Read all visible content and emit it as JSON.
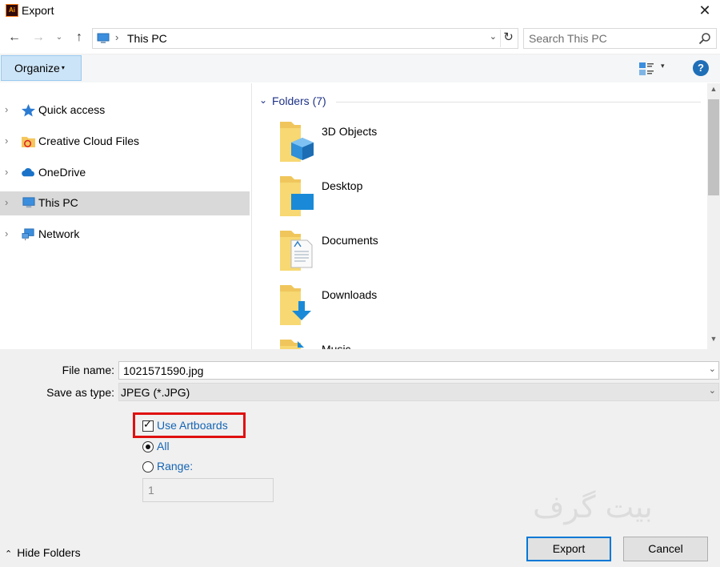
{
  "window": {
    "title": "Export",
    "app_icon_text": "Ai",
    "close_glyph": "✕"
  },
  "nav": {
    "back_glyph": "←",
    "forward_glyph": "→",
    "recent_glyph": "⌄",
    "up_glyph": "↑",
    "address_separator": "›",
    "address_text": "This PC",
    "address_dropdown_glyph": "⌄",
    "refresh_glyph": "↻",
    "search_placeholder": "Search This PC"
  },
  "toolbar": {
    "organize_label": "Organize",
    "organize_caret": "▾",
    "view_caret": "▾",
    "help_label": "?"
  },
  "sidebar": {
    "items": [
      {
        "label": "Quick access",
        "icon": "star-icon"
      },
      {
        "label": "Creative Cloud Files",
        "icon": "creative-cloud-folder-icon"
      },
      {
        "label": "OneDrive",
        "icon": "cloud-icon"
      },
      {
        "label": "This PC",
        "icon": "computer-icon",
        "selected": true
      },
      {
        "label": "Network",
        "icon": "network-icon"
      }
    ],
    "chevron_glyph": "›"
  },
  "content": {
    "group_label": "Folders (7)",
    "group_chevron": "⌄",
    "folders": [
      {
        "name": "3D Objects",
        "icon": "3d-objects-folder-icon"
      },
      {
        "name": "Desktop",
        "icon": "desktop-folder-icon"
      },
      {
        "name": "Documents",
        "icon": "documents-folder-icon"
      },
      {
        "name": "Downloads",
        "icon": "downloads-folder-icon"
      },
      {
        "name": "Music",
        "icon": "music-folder-icon"
      }
    ]
  },
  "scrollbar": {
    "up_glyph": "▲",
    "down_glyph": "▼"
  },
  "form": {
    "file_name_label": "File name:",
    "file_name_value": "1021571590.jpg",
    "save_as_type_label": "Save as type:",
    "save_as_type_value": "JPEG (*.JPG)",
    "dropdown_glyph": "⌄",
    "use_artboards_label": "Use Artboards",
    "use_artboards_checked": true,
    "check_glyph": "✓",
    "all_label": "All",
    "range_label": "Range:",
    "range_value": "1"
  },
  "watermark_text": "بیت گرف",
  "footer": {
    "hide_folders_label": "Hide Folders",
    "hide_folders_chevron": "⌃",
    "export_label": "Export",
    "cancel_label": "Cancel"
  },
  "colors": {
    "accent": "#0078d7",
    "link_blue": "#1464b4",
    "highlight_red": "#e01010",
    "folder_yellow": "#f7d16c"
  }
}
